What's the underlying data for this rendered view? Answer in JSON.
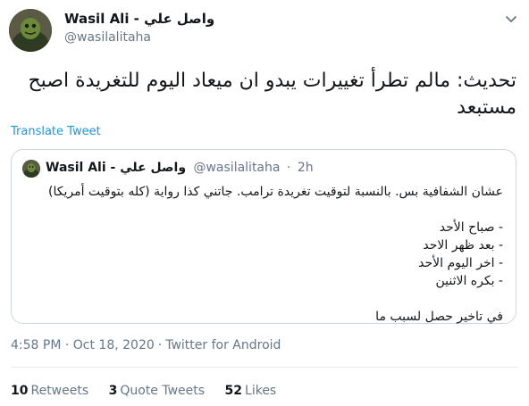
{
  "tweet": {
    "author_name": "Wasil Ali - واصل علي",
    "author_handle": "@wasilalitaha",
    "text": "تحديث: مالم تطرأ تغييرات يبدو ان ميعاد اليوم للتغريدة اصبح مستبعد",
    "translate_label": "Translate Tweet",
    "timestamp": "4:58 PM · Oct 18, 2020",
    "client": "Twitter for Android",
    "stats": {
      "retweets_count": "10",
      "retweets_label": "Retweets",
      "quotes_count": "3",
      "quotes_label": "Quote Tweets",
      "likes_count": "52",
      "likes_label": "Likes"
    }
  },
  "quote": {
    "author_name": "Wasil Ali - واصل علي",
    "author_handle": "@wasilalitaha",
    "separator": "·",
    "time": "2h",
    "lines": [
      "عشان الشفافية بس. بالنسبة لتوقيت تغريدة ترامب. جاتني كذا رواية (كله بتوقيت أمريكا)",
      "- صباح الأحد",
      "- بعد ظهر الاحد",
      "- اخر اليوم الأحد",
      "- بكره الاثنين",
      "في تاخير حصل لسبب ما"
    ]
  },
  "icons": {
    "more": "chevron-down-icon"
  },
  "colors": {
    "link": "#1b95e0",
    "secondary_text": "#657786",
    "border": "#ccd6dd"
  }
}
